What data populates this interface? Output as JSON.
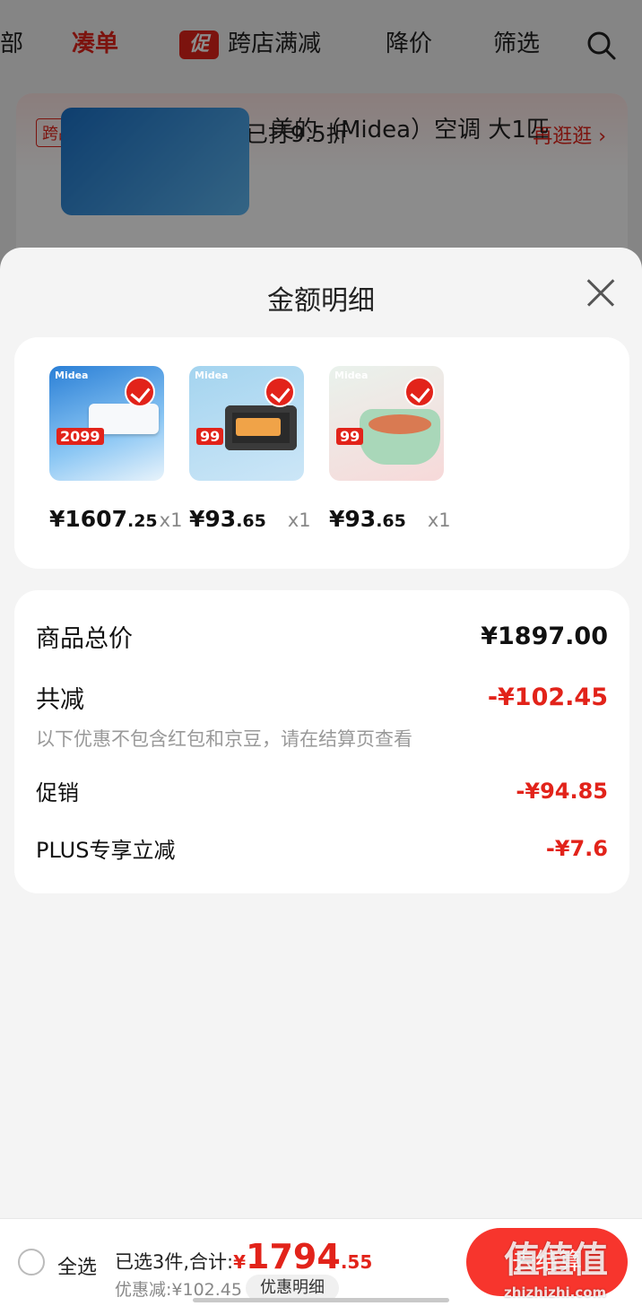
{
  "background": {
    "nav": {
      "partial_left": "部",
      "tab_active": "凑单",
      "promo_badge": "促",
      "promo_label": "跨店满减",
      "tab_price_drop": "降价",
      "tab_filter": "筛选"
    },
    "promo_tag": "跨品类满折",
    "promo_text": "已满3类，已打9.5折",
    "promo_more": "再逛逛 ›",
    "product_title": "美的（Midea）空调 大1匹"
  },
  "sheet": {
    "title": "金额明细",
    "products": [
      {
        "brand": "Midea",
        "tag": "2099",
        "price_int": "¥1607",
        "price_dec": ".25",
        "qty": "x1"
      },
      {
        "brand": "Midea",
        "tag": "99",
        "price_int": "¥93",
        "price_dec": ".65",
        "qty": "x1"
      },
      {
        "brand": "Midea",
        "tag": "99",
        "price_int": "¥93",
        "price_dec": ".65",
        "qty": "x1"
      }
    ],
    "summary": {
      "total_label": "商品总价",
      "total_value": "¥1897.00",
      "reduce_label": "共减",
      "reduce_value": "-¥102.45",
      "note": "以下优惠不包含红包和京豆，请在结算页查看",
      "promo_label": "促销",
      "promo_value": "-¥94.85",
      "plus_label": "PLUS专享立减",
      "plus_value": "-¥7.6"
    }
  },
  "bottom_bar": {
    "select_all": "全选",
    "selected_text": "已选3件,合计:",
    "currency": "¥",
    "total_int": "1794",
    "total_dec": ".55",
    "discount_text": "优惠减:¥102.45",
    "detail_button": "优惠明细",
    "checkout": "去结算",
    "watermark": "值值值",
    "watermark_url": "zhizhizhi.com"
  },
  "colors": {
    "accent": "#e2231a",
    "sheet_bg": "#f4f4f4",
    "card_bg": "#ffffff"
  },
  "icons": [
    "search-icon",
    "close-icon",
    "check-icon",
    "radio-icon",
    "chevron-right-icon"
  ]
}
